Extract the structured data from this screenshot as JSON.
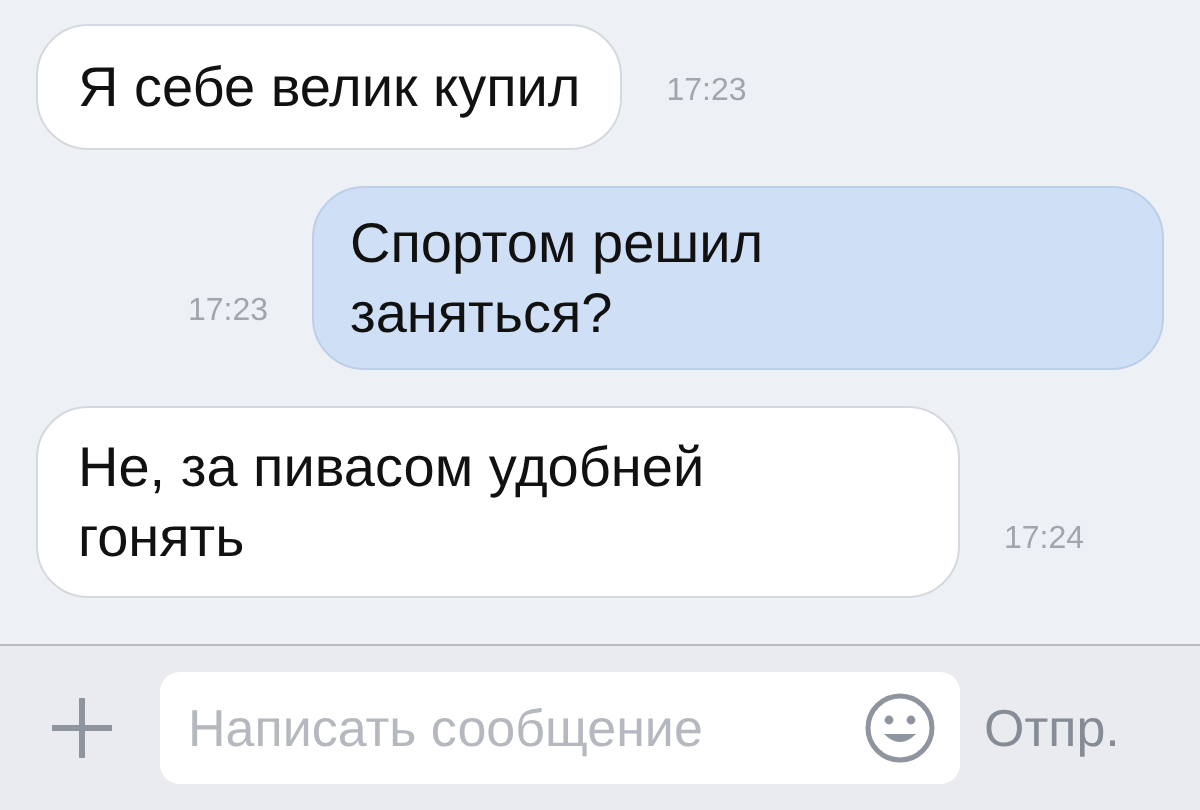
{
  "messages": [
    {
      "kind": "incoming",
      "text": "Я себе велик купил",
      "time": "17:23"
    },
    {
      "kind": "outgoing",
      "text": "Спортом решил заняться?",
      "time": "17:23"
    },
    {
      "kind": "incoming",
      "text": "Не, за пивасом удобней гонять",
      "time": "17:24"
    }
  ],
  "composer": {
    "placeholder": "Написать сообщение",
    "send_label": "Отпр."
  }
}
